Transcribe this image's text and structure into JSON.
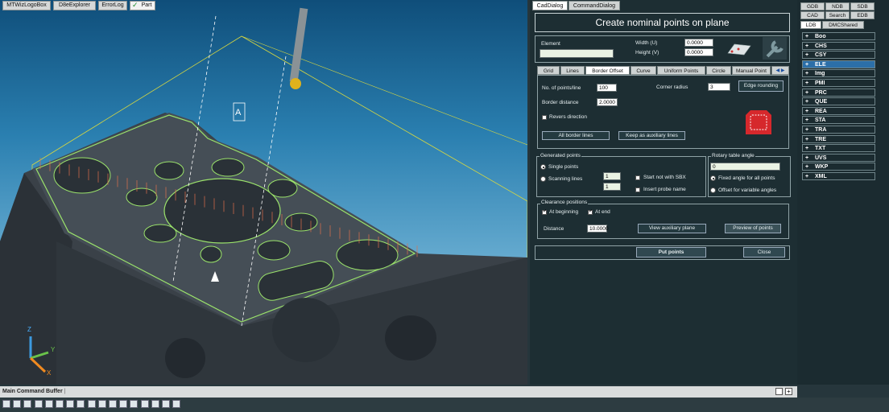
{
  "viewport": {
    "tabs": [
      "MTWizLogoBox",
      "D8eExplorer",
      "ErrorLog",
      "Part"
    ],
    "active_tab": "Part",
    "axis_labels": {
      "z": "Z",
      "y": "Y",
      "x": "X"
    },
    "marker": "A"
  },
  "dialog": {
    "tabs": [
      "CadDialog",
      "CommandDialog"
    ],
    "title": "Create nominal points on plane",
    "element_label": "Element",
    "element_value": "",
    "width_label": "Width (U)",
    "width_value": "0.0000",
    "height_label": "Height (V)",
    "height_value": "0.0000",
    "sub_tabs": [
      "Grid",
      "Lines",
      "Border Offset",
      "Curve",
      "Uniform Points",
      "Circle",
      "Manual Point"
    ],
    "active_sub_tab": "Border Offset",
    "points_line_label": "No. of points/line",
    "points_line_value": "100",
    "corner_radius_label": "Corner radius",
    "corner_radius_value": "3",
    "edge_rounding_label": "Edge rounding",
    "border_distance_label": "Border distance",
    "border_distance_value": "2.0000",
    "reverse_direction_label": "Revers direction",
    "all_border_lines_label": "All border lines",
    "keep_aux_label": "Keep as auxiliary lines",
    "generated_points": {
      "legend": "Generated points",
      "single_points": "Single points",
      "scanning_lines": "Scanning lines",
      "scan_value_1": "1",
      "scan_value_2": "1",
      "start_not_sbx": "Start not with SBX",
      "insert_probe": "Insert probe name"
    },
    "rotary": {
      "legend": "Rotary table angle",
      "value": "0",
      "fixed_angle": "Fixed angle for all points",
      "offset_variable": "Offset for variable angles"
    },
    "clearance": {
      "legend": "Clearance positions",
      "at_beginning": "At beginning",
      "at_end": "At end",
      "distance_label": "Distance",
      "distance_value": "10.0000",
      "view_aux_plane": "View auxiliary plane",
      "preview_points": "Preview of points"
    },
    "put_points": "Put points",
    "close": "Close"
  },
  "tree": {
    "top_tabs": [
      "GDB",
      "NDB",
      "SDB",
      "CAD",
      "Search",
      "EDB",
      "LDB",
      "DMCShared"
    ],
    "active_tab": "LDB",
    "items": [
      "Boo",
      "CHS",
      "CSY",
      "ELE",
      "Img",
      "PMI",
      "PRC",
      "QUE",
      "REA",
      "STA",
      "TRA",
      "TRE",
      "TXT",
      "UVS",
      "WKP",
      "XML"
    ],
    "selected_item": "ELE",
    "expander_symbol": "+"
  },
  "bottom": {
    "command_buffer_label": "Main Command Buffer"
  },
  "colors": {
    "highlight_green": "#9be36b",
    "part_dark": "#3a4148",
    "probe_tip": "#e0b21c",
    "selected_item_bg": "#2c6fa8"
  }
}
